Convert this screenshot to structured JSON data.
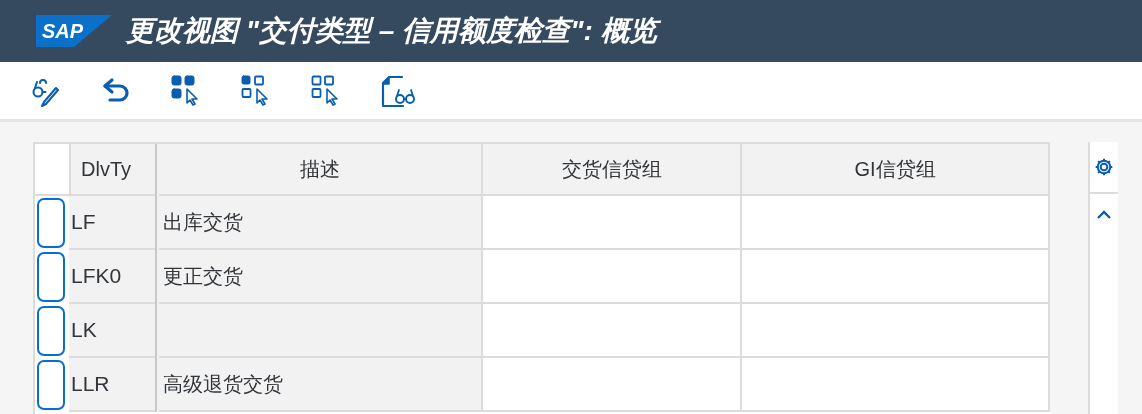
{
  "window": {
    "logo": "SAP",
    "title": "更改视图 \"交付类型 – 信用额度检查\": 概览"
  },
  "toolbar": [
    {
      "kind": "glasses-pencil"
    },
    {
      "kind": "back"
    },
    {
      "kind": "select-all"
    },
    {
      "kind": "select-block"
    },
    {
      "kind": "deselect-all"
    },
    {
      "kind": "document-glasses"
    }
  ],
  "table": {
    "columns": [
      "DlvTy",
      "描述",
      "交货信贷组",
      "GI信贷组"
    ],
    "rows": [
      {
        "selected": false,
        "cells": [
          "LF",
          "出库交货",
          "",
          ""
        ]
      },
      {
        "selected": false,
        "cells": [
          "LFK0",
          "更正交货",
          "",
          ""
        ]
      },
      {
        "selected": false,
        "cells": [
          "LK",
          "",
          "",
          ""
        ]
      },
      {
        "selected": false,
        "cells": [
          "LLR",
          "高级退货交货",
          "",
          ""
        ]
      }
    ]
  }
}
